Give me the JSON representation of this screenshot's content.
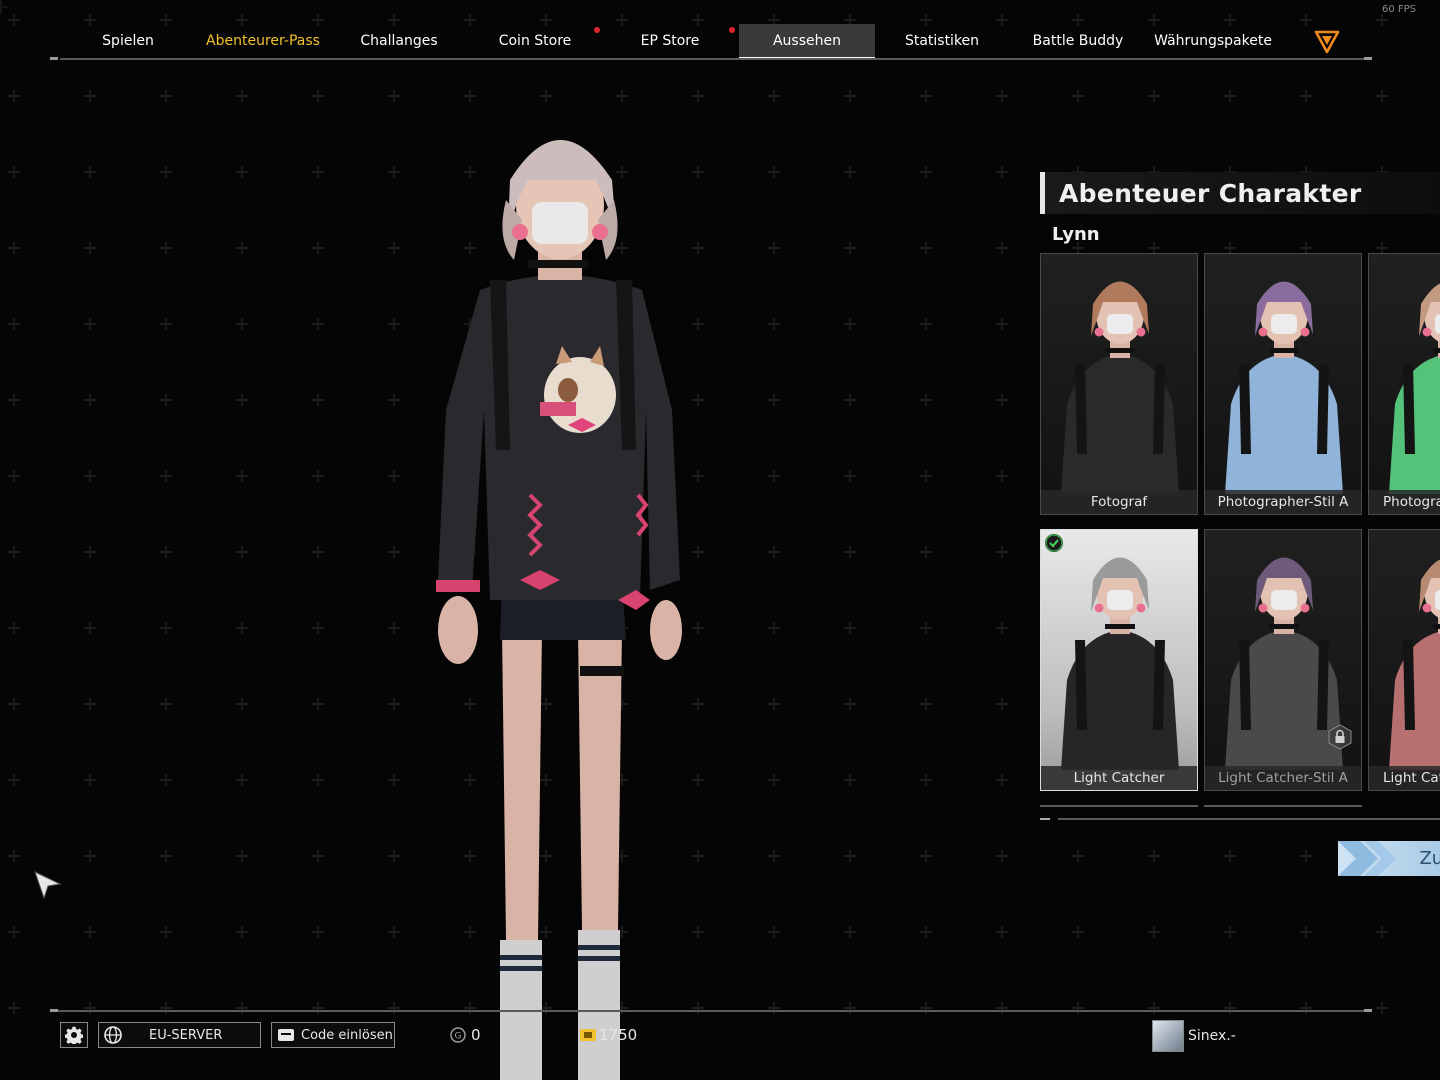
{
  "fps": "60 FPS",
  "nav": {
    "tabs": [
      {
        "label": "Spielen"
      },
      {
        "label": "Abenteurer-Pass"
      },
      {
        "label": "Challanges"
      },
      {
        "label": "Coin Store"
      },
      {
        "label": "EP Store"
      },
      {
        "label": "Aussehen"
      },
      {
        "label": "Statistiken"
      },
      {
        "label": "Battle Buddy"
      },
      {
        "label": "Währungspakete"
      }
    ],
    "active_tab": "Aussehen",
    "highlight_tab": "Abenteurer-Pass",
    "notification_tabs": [
      "Coin Store",
      "EP Store"
    ]
  },
  "panel": {
    "title": "Abenteuer Charakter",
    "character_name": "Lynn",
    "skins": [
      {
        "label": "Fotograf",
        "sweater_color": "#2a2a2a",
        "hair_color": "#b07b5c",
        "selected": false,
        "locked": false
      },
      {
        "label": "Photographer-Stil A",
        "sweater_color": "#8fb3d9",
        "hair_color": "#8a6d9e",
        "selected": false,
        "locked": false
      },
      {
        "label": "Photogra",
        "sweater_color": "#55c27a",
        "hair_color": "#c29a80",
        "selected": false,
        "locked": false
      },
      {
        "label": "Light Catcher",
        "sweater_color": "#262626",
        "hair_color": "#9a9a9a",
        "selected": true,
        "locked": false
      },
      {
        "label": "Light Catcher-Stil A",
        "sweater_color": "#4a4a4a",
        "hair_color": "#6e5a7a",
        "selected": false,
        "locked": true
      },
      {
        "label": "Light Cat",
        "sweater_color": "#b86f6f",
        "hair_color": "#b98a72",
        "selected": false,
        "locked": false
      }
    ],
    "back_label": "Zurü"
  },
  "bottom": {
    "server_label": "EU-SERVER",
    "code_label": "Code einlösen",
    "currency_g": "0",
    "currency_gold": "1750",
    "username": "Sinex.-"
  },
  "colors": {
    "gold": "#f2c12e",
    "notification": "#e0262b",
    "back_button": "#b9d6ee",
    "logo_orange": "#f08a1c"
  },
  "icons": {
    "settings": "gear-icon",
    "server": "globe-icon",
    "code": "ticket-icon",
    "currency_g": "g-coin-icon",
    "currency_gold": "gold-coin-icon",
    "logo": "triangle-logo-icon"
  }
}
